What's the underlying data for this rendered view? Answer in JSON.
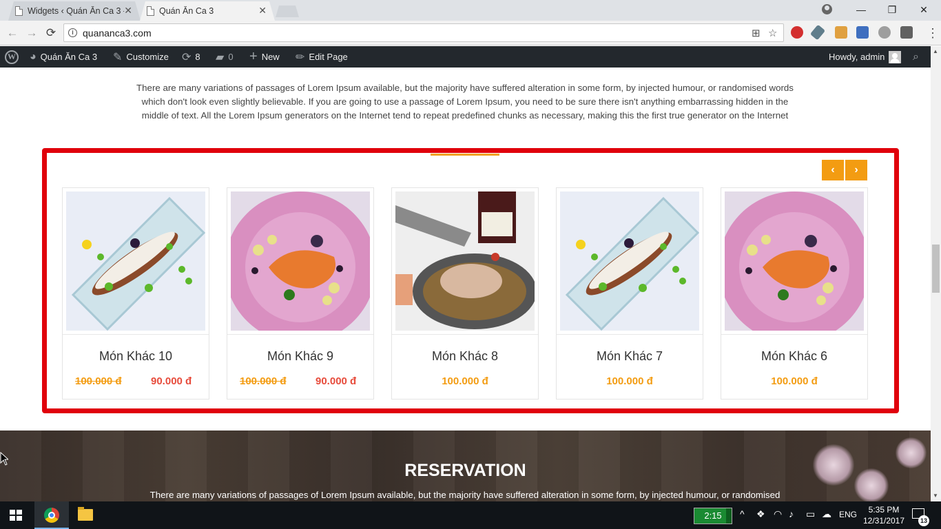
{
  "browser": {
    "tabs": [
      {
        "title": "Widgets ‹ Quán Ăn Ca 3 —",
        "active": false
      },
      {
        "title": "Quán Ăn Ca 3",
        "active": true
      }
    ],
    "url": "quananca3.com",
    "window_controls": {
      "minimize": "—",
      "restore": "❐",
      "close": "✕"
    }
  },
  "adminbar": {
    "site_name": "Quán Ăn Ca 3",
    "customize": "Customize",
    "updates_count": "8",
    "comments_count": "0",
    "new": "New",
    "edit_page": "Edit Page",
    "howdy": "Howdy, admin"
  },
  "page": {
    "intro_text": "There are many variations of passages of Lorem Ipsum available, but the majority have suffered alteration in some form, by injected humour, or randomised words which don't look even slightly believable. If you are going to use a passage of Lorem Ipsum, you need to be sure there isn't anything embarrassing hidden in the middle of text. All the Lorem Ipsum generators on the Internet tend to repeat predefined chunks as necessary, making this the first true generator on the Internet",
    "slider": {
      "prev_label": "‹",
      "next_label": "›",
      "items": [
        {
          "name": "Món Khác 10",
          "old_price": "100.000 đ",
          "price": "90.000 đ",
          "image": "fish-glass-plate"
        },
        {
          "name": "Món Khác 9",
          "old_price": "100.000 đ",
          "price": "90.000 đ",
          "image": "duck-pink-plate"
        },
        {
          "name": "Món Khác 8",
          "price": "100.000 đ",
          "image": "terrine-silver-plate"
        },
        {
          "name": "Món Khác 7",
          "price": "100.000 đ",
          "image": "fish-glass-plate"
        },
        {
          "name": "Món Khác 6",
          "price": "100.000 đ",
          "image": "duck-pink-plate"
        }
      ]
    },
    "reservation": {
      "title": "RESERVATION",
      "text": "There are many variations of passages of Lorem Ipsum available, but the majority have suffered alteration in some form, by injected humour, or randomised"
    }
  },
  "colors": {
    "frame_red": "#e0000b",
    "accent_orange": "#f39c12",
    "sale_red": "#e74c3c",
    "adminbar_bg": "#23282d"
  },
  "taskbar": {
    "battery_timer": "2:15",
    "language": "ENG",
    "time": "5:35 PM",
    "date": "12/31/2017",
    "notification_count": "13"
  }
}
